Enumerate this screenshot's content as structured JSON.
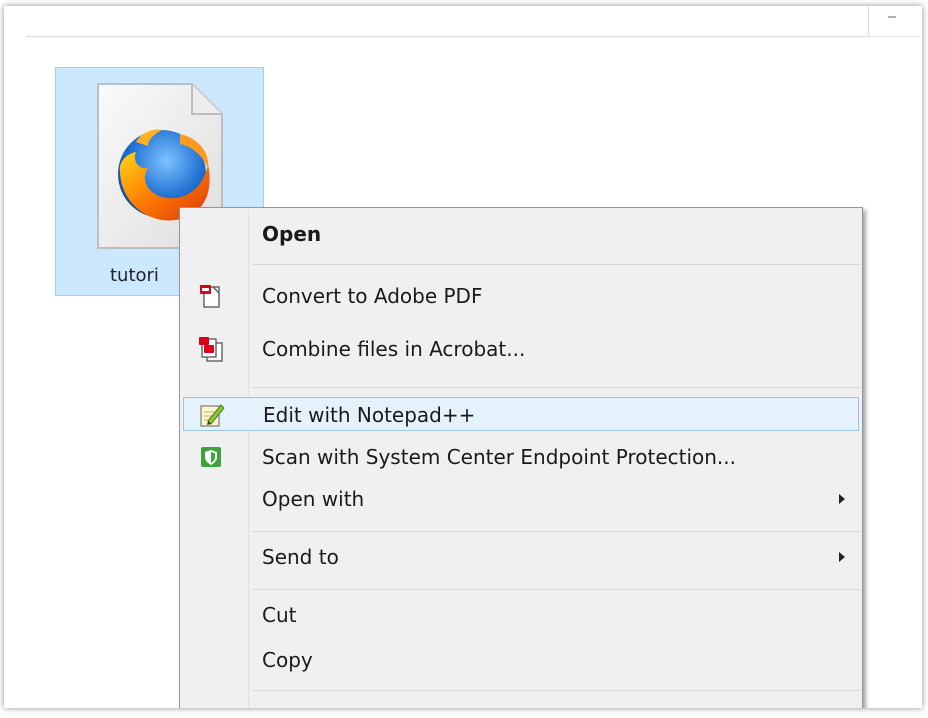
{
  "file": {
    "name": "tutorial",
    "visible_label": "tutori",
    "icon": "firefox-document-icon",
    "selected": true
  },
  "colors": {
    "selection_bg": "#cce8ff",
    "selection_border": "#99d1ff",
    "menu_bg": "#f0f0f0",
    "highlight_bg": "#e5f1fb",
    "highlight_border": "#9bc5e8",
    "acrobat_red": "#d9001b",
    "scep_green": "#3fa23b"
  },
  "context_menu": {
    "items": [
      {
        "label": "Open",
        "bold": true,
        "icon": ""
      },
      {
        "label": "Convert to Adobe PDF",
        "icon": "acrobat-convert-icon"
      },
      {
        "label": "Combine files in Acrobat...",
        "icon": "acrobat-combine-icon"
      },
      {
        "label": "Edit with Notepad++",
        "icon": "notepad-plus-plus-icon",
        "highlighted": true
      },
      {
        "label": "Scan with System Center Endpoint Protection...",
        "icon": "endpoint-protection-shield-icon"
      },
      {
        "label": "Open with",
        "submenu": true,
        "icon": ""
      },
      {
        "label": "Send to",
        "submenu": true,
        "icon": ""
      },
      {
        "label": "Cut",
        "icon": ""
      },
      {
        "label": "Copy",
        "icon": ""
      }
    ]
  }
}
